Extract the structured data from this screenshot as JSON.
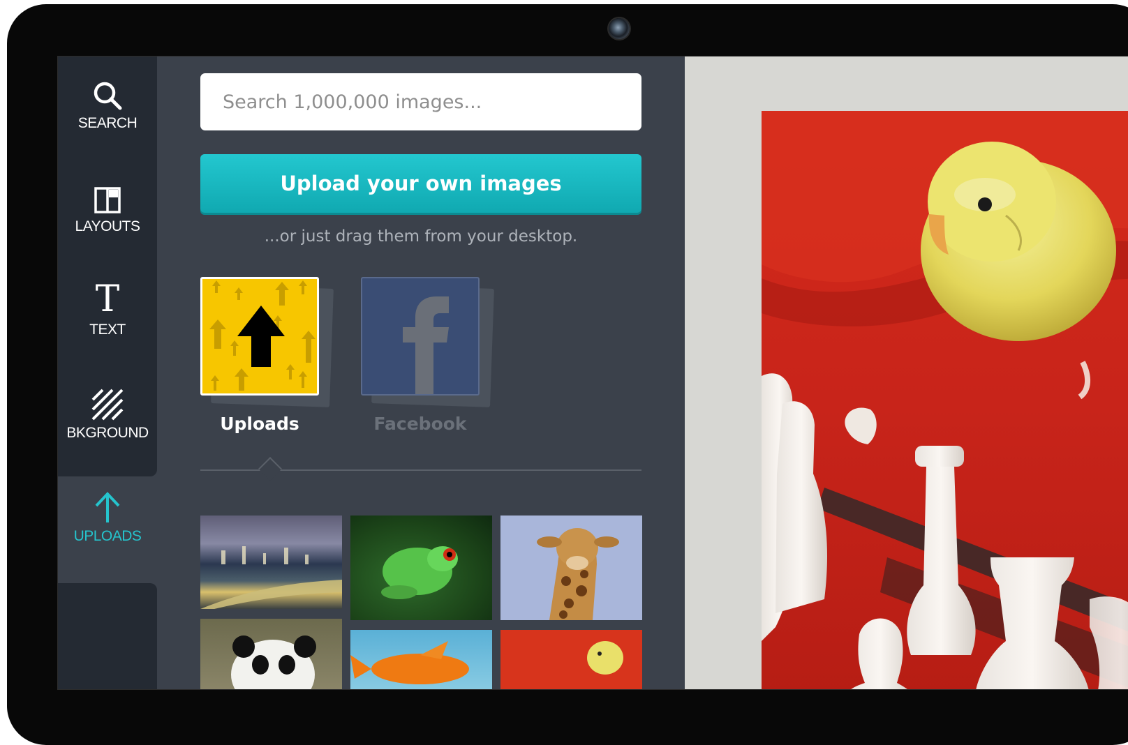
{
  "nav": {
    "items": [
      {
        "label": "SEARCH",
        "icon": "search-icon"
      },
      {
        "label": "LAYOUTS",
        "icon": "layouts-icon"
      },
      {
        "label": "TEXT",
        "icon": "text-icon"
      },
      {
        "label": "BKGROUND",
        "icon": "background-icon"
      },
      {
        "label": "UPLOADS",
        "icon": "upload-arrow-icon",
        "active": true
      }
    ],
    "text_glyph": "T"
  },
  "panel": {
    "search": {
      "placeholder": "Search 1,000,000 images..."
    },
    "upload_button": "Upload your own images",
    "hint": "...or just drag them from your desktop.",
    "sources": [
      {
        "name": "Uploads",
        "icon": "uploads-icon",
        "active": true
      },
      {
        "name": "Facebook",
        "icon": "facebook-icon",
        "active": false
      }
    ],
    "thumbnails": [
      "city-night",
      "tree-frog",
      "giraffe",
      "panda",
      "goldfish",
      "parakeet"
    ]
  },
  "canvas": {
    "image": "parakeet-chess-photo"
  },
  "colors": {
    "accent": "#25c4cd",
    "nav_bg": "#242a33",
    "panel_bg": "#3b414b",
    "uploads_yellow": "#f7c600",
    "facebook_blue": "#3a4d74"
  }
}
